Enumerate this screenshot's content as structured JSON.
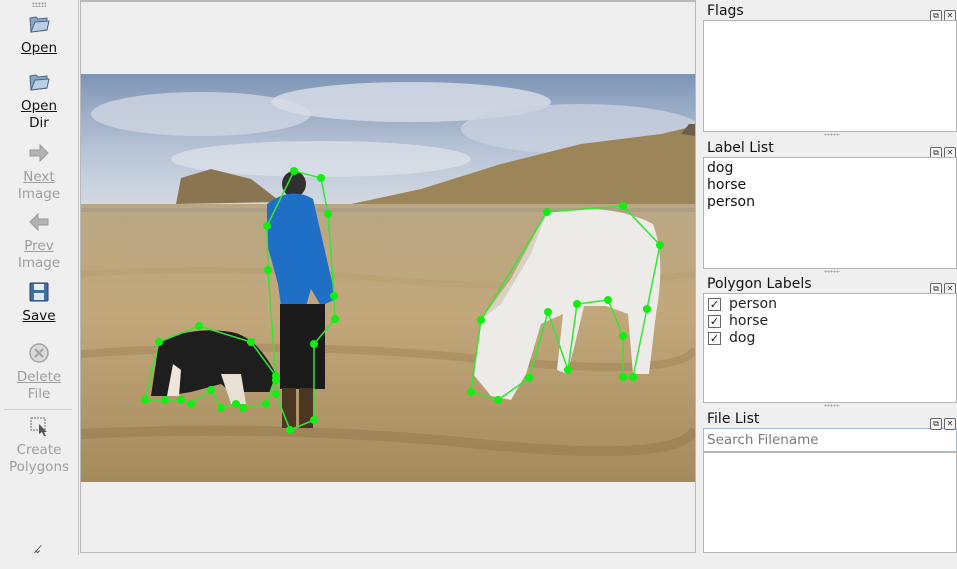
{
  "toolbar": {
    "open_label": "Open",
    "open_dir_label_1": "Open",
    "open_dir_label_2": "Dir",
    "next_label_1": "Next",
    "next_label_2": "Image",
    "prev_label_1": "Prev",
    "prev_label_2": "Image",
    "save_label": "Save",
    "delete_label_1": "Delete",
    "delete_label_2": "File",
    "create_label_1": "Create",
    "create_label_2": "Polygons",
    "more_icon": "chevron-double-down-icon"
  },
  "docks": {
    "flags": {
      "title": "Flags"
    },
    "label_list": {
      "title": "Label List",
      "items": [
        "dog",
        "horse",
        "person"
      ]
    },
    "polygon_labels": {
      "title": "Polygon Labels",
      "items": [
        {
          "label": "person",
          "checked": true
        },
        {
          "label": "horse",
          "checked": true
        },
        {
          "label": "dog",
          "checked": true
        }
      ]
    },
    "file_list": {
      "title": "File List",
      "search_placeholder": "Search Filename"
    }
  },
  "colors": {
    "polygon": "#00e000",
    "vertex": "#11ee11",
    "accent": "#9fbbd8"
  }
}
